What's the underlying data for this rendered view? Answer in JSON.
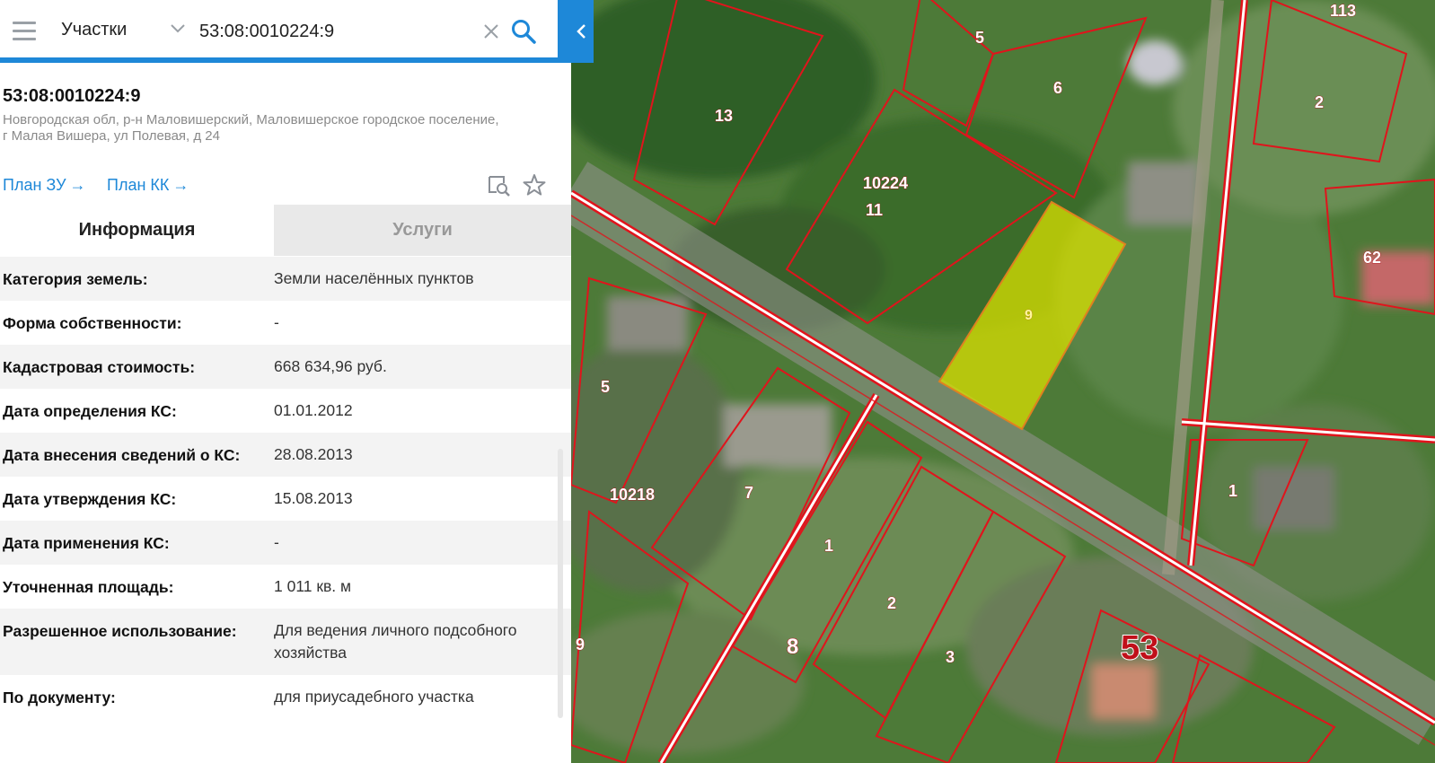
{
  "search": {
    "layer": "Участки",
    "query": "53:08:0010224:9"
  },
  "parcel": {
    "number": "53:08:0010224:9",
    "address_line1": "Новгородская обл, р-н Маловишерский, Маловишерское городское поселение,",
    "address_line2": "г Малая Вишера, ул Полевая, д 24"
  },
  "links": {
    "plan_zu": "План ЗУ",
    "plan_kk": "План КК",
    "arrow": "→"
  },
  "tabs": {
    "info": "Информация",
    "services": "Услуги"
  },
  "info": [
    {
      "label": "Категория земель:",
      "value": "Земли населённых пунктов"
    },
    {
      "label": "Форма собственности:",
      "value": "-"
    },
    {
      "label": "Кадастровая стоимость:",
      "value": "668 634,96 руб."
    },
    {
      "label": "Дата определения КС:",
      "value": "01.01.2012"
    },
    {
      "label": "Дата внесения сведений о КС:",
      "value": "28.08.2013"
    },
    {
      "label": "Дата утверждения КС:",
      "value": "15.08.2013"
    },
    {
      "label": "Дата применения КС:",
      "value": "-"
    },
    {
      "label": "Уточненная площадь:",
      "value": "1 011 кв. м"
    },
    {
      "label": "Разрешенное использование:",
      "value": "Для ведения личного подсобного хозяйства"
    },
    {
      "label": "По документу:",
      "value": "для приусадебного участка"
    }
  ],
  "map": {
    "labels": {
      "l113": "113",
      "l5a": "5",
      "l13": "13",
      "l6": "6",
      "l2a": "2",
      "l10224": "10224",
      "l11": "11",
      "l9": "9",
      "l62": "62",
      "l5b": "5",
      "l10218": "10218",
      "l7": "7",
      "l1a": "1",
      "l1b": "1",
      "l2b": "2",
      "l8": "8",
      "l3": "3",
      "l9b": "9",
      "l53": "53"
    },
    "colors": {
      "boundary": "#e0141c",
      "selected_fill": "#d9e000",
      "selected_stroke": "#e08020",
      "accent": "#1e88d8"
    }
  }
}
